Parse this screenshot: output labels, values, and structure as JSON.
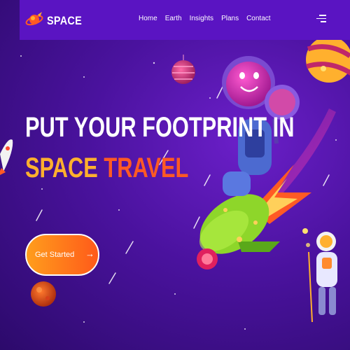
{
  "brand": {
    "name": "SPACE"
  },
  "nav": {
    "links": [
      "Home",
      "Earth",
      "Insights",
      "Plans",
      "Contact"
    ]
  },
  "hero": {
    "title_line1": "PUT YOUR FOOTPRINT IN",
    "title_word1": "SPACE",
    "title_word2": "TRAVEL",
    "cta_label": "Get Started",
    "cta_arrow": "→"
  },
  "colors": {
    "background": "#4a129e",
    "navbar": "#5a14c2",
    "accent_orange": "#ff5a24",
    "accent_yellow": "#ffb02e"
  },
  "icons": [
    "rocket-logo-icon",
    "menu-icon",
    "arrow-right-icon"
  ]
}
